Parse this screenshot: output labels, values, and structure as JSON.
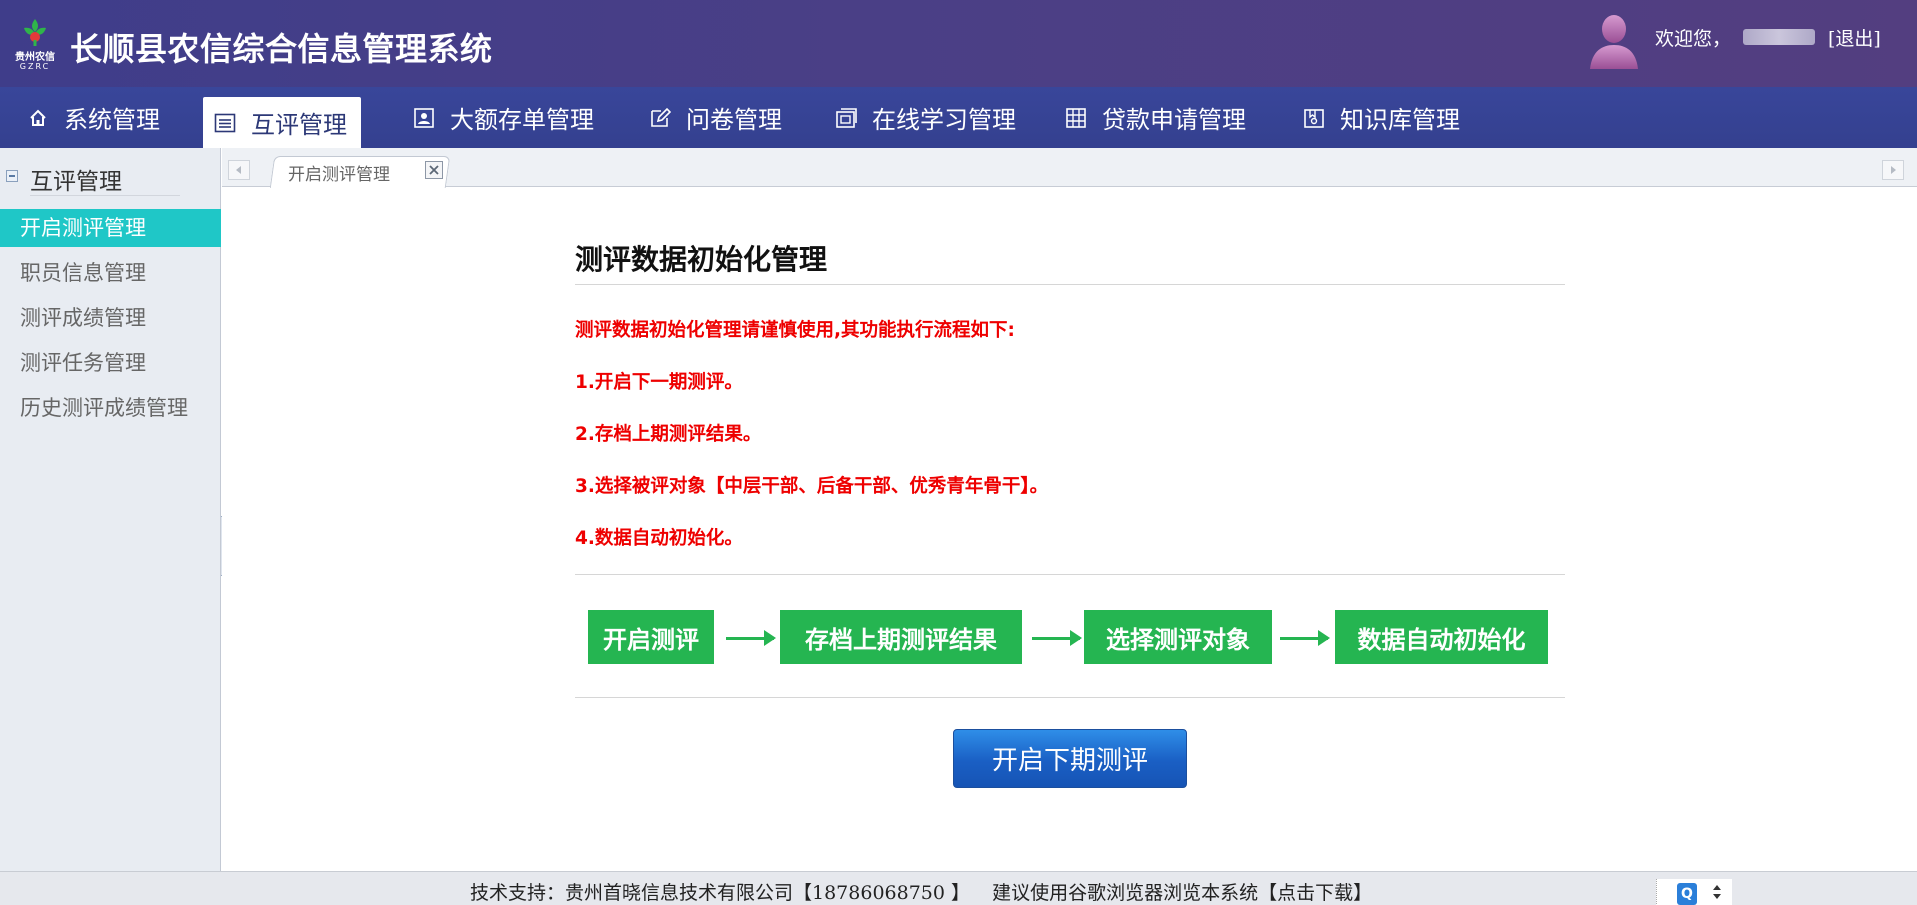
{
  "header": {
    "logo_text_cn": "贵州农信",
    "logo_text_en": "GZRC",
    "title": "长顺县农信综合信息管理系统",
    "welcome": "欢迎您，",
    "logout": "[退出]"
  },
  "nav": {
    "items": [
      {
        "label": "系统管理",
        "icon": "home-icon"
      },
      {
        "label": "互评管理",
        "icon": "list-icon",
        "active": true
      },
      {
        "label": "大额存单管理",
        "icon": "user-card-icon"
      },
      {
        "label": "问卷管理",
        "icon": "edit-icon"
      },
      {
        "label": "在线学习管理",
        "icon": "frame-icon"
      },
      {
        "label": "贷款申请管理",
        "icon": "grid-icon"
      },
      {
        "label": "知识库管理",
        "icon": "book-icon"
      }
    ]
  },
  "sidebar": {
    "title": "互评管理",
    "items": [
      {
        "label": "开启测评管理",
        "active": true
      },
      {
        "label": "职员信息管理"
      },
      {
        "label": "测评成绩管理"
      },
      {
        "label": "测评任务管理"
      },
      {
        "label": "历史测评成绩管理"
      }
    ]
  },
  "tabs": [
    {
      "label": "开启测评管理",
      "active": true
    }
  ],
  "panel": {
    "title": "测评数据初始化管理",
    "notice": "测评数据初始化管理请谨慎使用,其功能执行流程如下:",
    "steps": [
      "1.开启下一期测评。",
      "2.存档上期测评结果。",
      "3.选择被评对象【中层干部、后备干部、优秀青年骨干】。",
      "4.数据自动初始化。"
    ],
    "flow": [
      "开启测评",
      "存档上期测评结果",
      "选择测评对象",
      "数据自动初始化"
    ],
    "start_button": "开启下期测评"
  },
  "footer": {
    "support": "技术支持：贵州首晓信息技术有限公司【18786068750 】",
    "suggest_prefix": "建议使用谷歌浏览器浏览本系统",
    "download_link": "【点击下载】",
    "widget_label": "Q"
  },
  "colors": {
    "header_bg": "#443f88",
    "nav_bg": "#37449a",
    "sidebar_active": "#1fc7c7",
    "warning_red": "#ee0000",
    "flow_green": "#25b551",
    "button_blue": "#1a5fc4"
  }
}
